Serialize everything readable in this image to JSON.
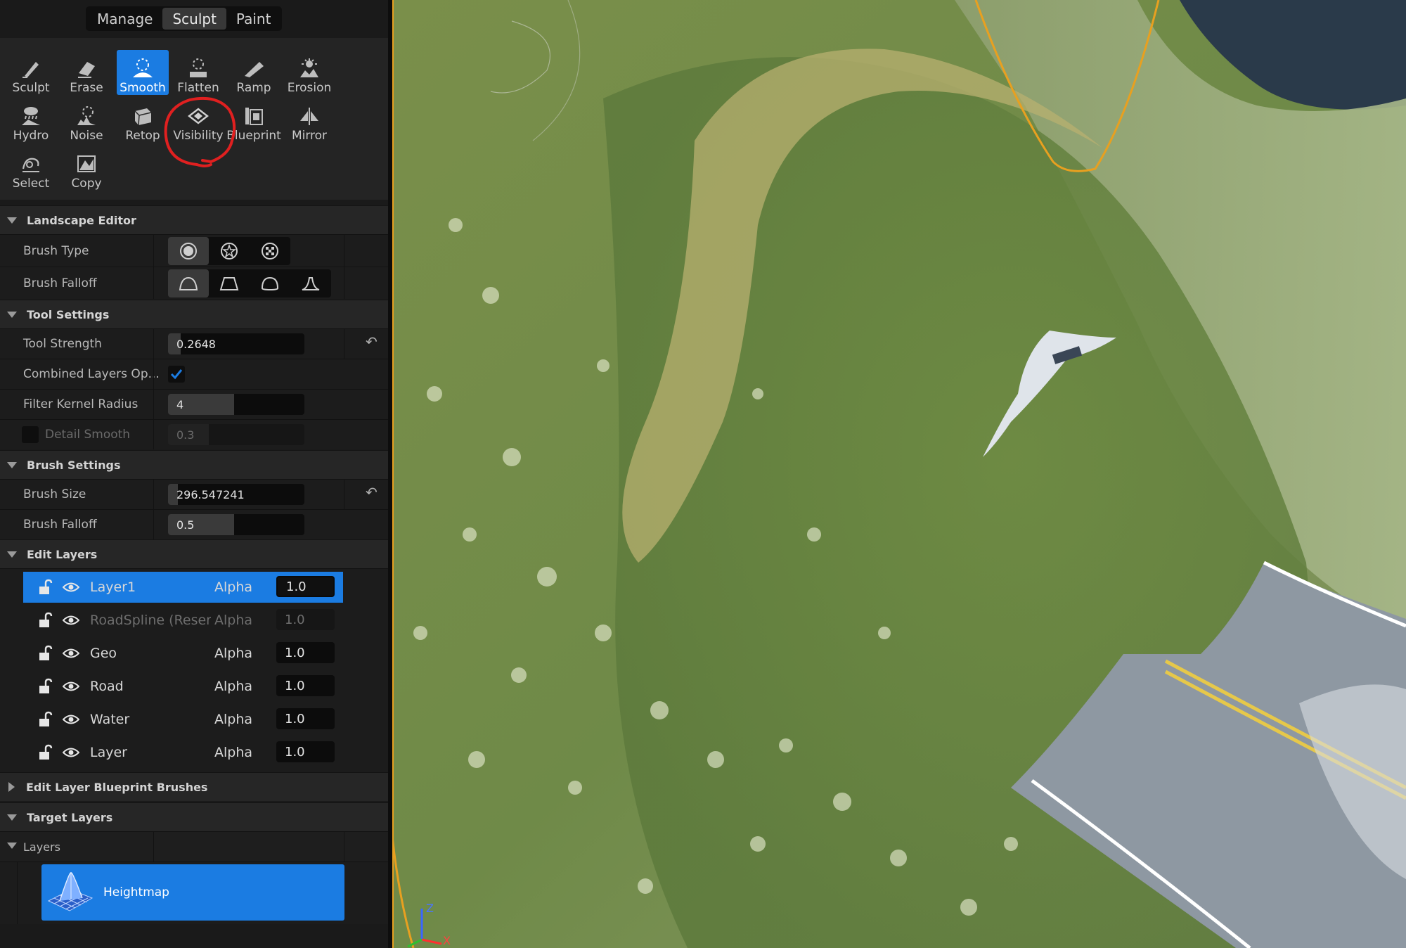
{
  "modes": [
    "Manage",
    "Sculpt",
    "Paint"
  ],
  "active_mode": "Sculpt",
  "tools": [
    {
      "label": "Sculpt",
      "icon": "sculpt-icon"
    },
    {
      "label": "Erase",
      "icon": "erase-icon"
    },
    {
      "label": "Smooth",
      "icon": "smooth-icon",
      "active": true
    },
    {
      "label": "Flatten",
      "icon": "flatten-icon"
    },
    {
      "label": "Ramp",
      "icon": "ramp-icon"
    },
    {
      "label": "Erosion",
      "icon": "erosion-icon"
    },
    {
      "label": "Hydro",
      "icon": "hydro-icon"
    },
    {
      "label": "Noise",
      "icon": "noise-icon"
    },
    {
      "label": "Retop",
      "icon": "retop-icon"
    },
    {
      "label": "Visibility",
      "icon": "visibility-icon"
    },
    {
      "label": "Blueprint",
      "icon": "blueprint-icon"
    },
    {
      "label": "Mirror",
      "icon": "mirror-icon"
    },
    {
      "label": "Select",
      "icon": "select-icon"
    },
    {
      "label": "Copy",
      "icon": "copy-icon"
    }
  ],
  "sections": {
    "landscape_editor": "Landscape Editor",
    "tool_settings": "Tool Settings",
    "brush_settings": "Brush Settings",
    "edit_layers": "Edit Layers",
    "edit_layer_blueprint_brushes": "Edit Layer Blueprint Brushes",
    "target_layers": "Target Layers"
  },
  "landscape_editor": {
    "brush_type_label": "Brush Type",
    "brush_falloff_label": "Brush Falloff"
  },
  "tool_settings": {
    "tool_strength_label": "Tool Strength",
    "tool_strength_value": "0.2648",
    "combined_layers_label": "Combined Layers Op...",
    "combined_layers_checked": true,
    "filter_kernel_label": "Filter Kernel Radius",
    "filter_kernel_value": "4",
    "detail_smooth_label": "Detail Smooth",
    "detail_smooth_value": "0.3"
  },
  "brush_settings": {
    "brush_size_label": "Brush Size",
    "brush_size_value": "296.547241",
    "brush_falloff_label": "Brush Falloff",
    "brush_falloff_value": "0.5"
  },
  "edit_layers": [
    {
      "name": "Layer1",
      "alpha_label": "Alpha",
      "alpha": "1.0",
      "selected": true
    },
    {
      "name": "RoadSpline (Reserved)",
      "alpha_label": "Alpha",
      "alpha": "1.0",
      "dimmed": true
    },
    {
      "name": "Geo",
      "alpha_label": "Alpha",
      "alpha": "1.0"
    },
    {
      "name": "Road",
      "alpha_label": "Alpha",
      "alpha": "1.0"
    },
    {
      "name": "Water",
      "alpha_label": "Alpha",
      "alpha": "1.0"
    },
    {
      "name": "Layer",
      "alpha_label": "Alpha",
      "alpha": "1.0"
    }
  ],
  "target_layers": {
    "layers_label": "Layers",
    "heightmap_label": "Heightmap"
  },
  "viewport": {
    "gizmo_axes": [
      "Z",
      "X"
    ],
    "accent_color": "#1b7ce2",
    "border_color": "#e8a020",
    "annotation_color": "#e02020"
  }
}
